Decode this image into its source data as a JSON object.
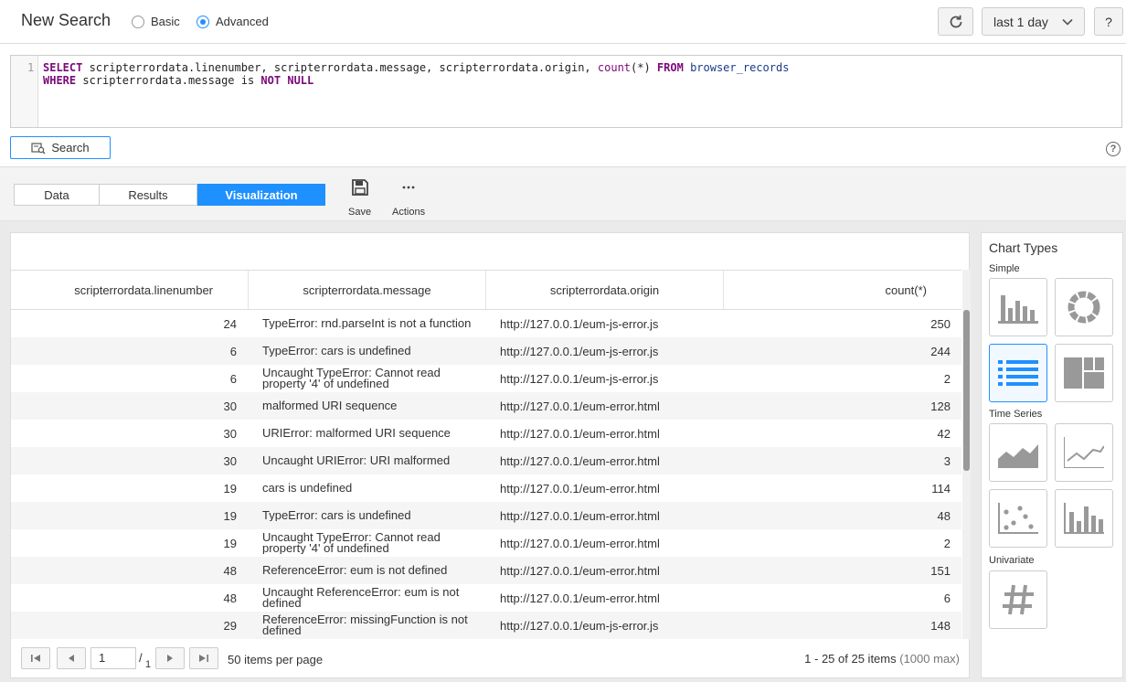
{
  "header": {
    "title": "New Search",
    "mode_basic": "Basic",
    "mode_advanced": "Advanced",
    "time_range": "last 1 day",
    "help_label": "?"
  },
  "editor": {
    "line_number": "1",
    "query": "SELECT scripterrordata.linenumber, scripterrordata.message, scripterrordata.origin, count(*) FROM browser_records WHERE scripterrordata.message is NOT NULL"
  },
  "search_button": "Search",
  "tabs": [
    {
      "label": "Data"
    },
    {
      "label": "Results"
    },
    {
      "label": "Visualization"
    }
  ],
  "tools": {
    "save": "Save",
    "actions": "Actions"
  },
  "table": {
    "columns": [
      "scripterrordata.linenumber",
      "scripterrordata.message",
      "scripterrordata.origin",
      "count(*)"
    ],
    "rows": [
      {
        "line": "24",
        "message": "TypeError: rnd.parseInt is not a function",
        "origin": "http://127.0.0.1/eum-js-error.js",
        "count": "250"
      },
      {
        "line": "6",
        "message": "TypeError: cars is undefined",
        "origin": "http://127.0.0.1/eum-js-error.js",
        "count": "244"
      },
      {
        "line": "6",
        "message": "Uncaught TypeError: Cannot read property '4' of undefined",
        "origin": "http://127.0.0.1/eum-js-error.js",
        "count": "2"
      },
      {
        "line": "30",
        "message": "malformed URI sequence",
        "origin": "http://127.0.0.1/eum-error.html",
        "count": "128"
      },
      {
        "line": "30",
        "message": "URIError: malformed URI sequence",
        "origin": "http://127.0.0.1/eum-error.html",
        "count": "42"
      },
      {
        "line": "30",
        "message": "Uncaught URIError: URI malformed",
        "origin": "http://127.0.0.1/eum-error.html",
        "count": "3"
      },
      {
        "line": "19",
        "message": "cars is undefined",
        "origin": "http://127.0.0.1/eum-error.html",
        "count": "114"
      },
      {
        "line": "19",
        "message": "TypeError: cars is undefined",
        "origin": "http://127.0.0.1/eum-error.html",
        "count": "48"
      },
      {
        "line": "19",
        "message": "Uncaught TypeError: Cannot read property '4' of undefined",
        "origin": "http://127.0.0.1/eum-error.html",
        "count": "2"
      },
      {
        "line": "48",
        "message": "ReferenceError: eum is not defined",
        "origin": "http://127.0.0.1/eum-error.html",
        "count": "151"
      },
      {
        "line": "48",
        "message": "Uncaught ReferenceError: eum is not defined",
        "origin": "http://127.0.0.1/eum-error.html",
        "count": "6"
      },
      {
        "line": "29",
        "message": "ReferenceError: missingFunction is not defined",
        "origin": "http://127.0.0.1/eum-js-error.js",
        "count": "148"
      }
    ]
  },
  "pager": {
    "page": "1",
    "total_pages": "1",
    "per_page": "50 items per page",
    "summary": "1 - 25 of 25 items",
    "max_note": "(1000 max)"
  },
  "chart_types": {
    "title": "Chart Types",
    "sections": {
      "simple": "Simple",
      "time_series": "Time Series",
      "univariate": "Univariate"
    },
    "icons": [
      "bar-chart-icon",
      "donut-chart-icon",
      "list-icon",
      "treemap-icon",
      "area-chart-icon",
      "line-chart-icon",
      "scatter-chart-icon",
      "column-chart-icon",
      "hash-icon"
    ],
    "selected": "list-icon"
  },
  "colors": {
    "accent": "#1e90ff",
    "keyword": "#7a0a7a",
    "icon_gray": "#999999"
  }
}
